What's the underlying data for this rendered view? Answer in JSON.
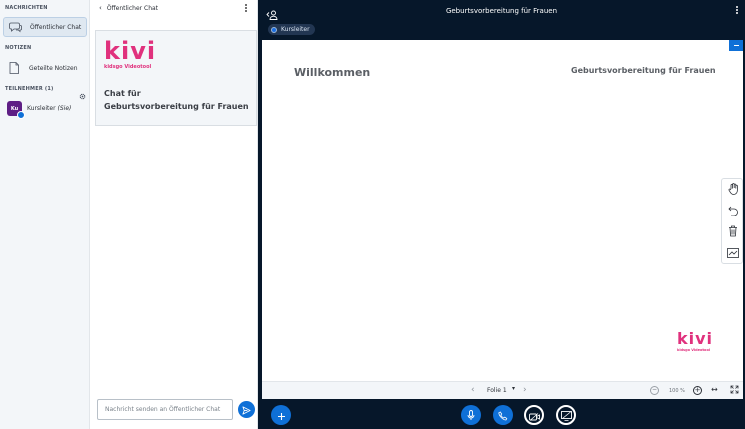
{
  "userlist": {
    "messages_title": "NACHRICHTEN",
    "public_chat": "Öffentlicher Chat",
    "notes_title": "NOTIZEN",
    "shared_notes": "Geteilte Notizen",
    "participants_title": "TEILNEHMER (1)",
    "users": [
      {
        "initials": "Ku",
        "name": "Kursleiter",
        "you": "(Sie)"
      }
    ]
  },
  "chat": {
    "title": "Öffentlicher Chat",
    "welcome": {
      "logo": "kivi",
      "logo_sub": "kidsgo Videotool",
      "line1": "Chat für",
      "line2": "Geburtsvorbereitung für Frauen"
    },
    "input_placeholder": "Nachricht senden an Öffentlicher Chat"
  },
  "presentation": {
    "meeting_title": "Geburtsvorbereitung für Frauen",
    "presenter": "Kursleiter",
    "slide": {
      "left_text": "Willkommen",
      "right_text": "Geburtsvorbereitung für Frauen",
      "logo": "kivi",
      "logo_sub": "kidsgo Videotool"
    },
    "footer": {
      "slide_label": "Folie 1",
      "zoom": "100 %"
    }
  },
  "colors": {
    "brand_pink": "#e0317d",
    "accent_blue": "#0f70d7",
    "main_bg": "#06172a"
  },
  "icons": {
    "public_chat": "chat-bubble-icon",
    "shared_notes": "note-icon",
    "settings": "gear-icon",
    "tools": [
      "hand-icon",
      "undo-icon",
      "trash-icon",
      "chart-icon"
    ],
    "bottom": [
      "plus-icon",
      "microphone-icon",
      "phone-icon",
      "camera-icon",
      "screenshare-icon"
    ]
  }
}
